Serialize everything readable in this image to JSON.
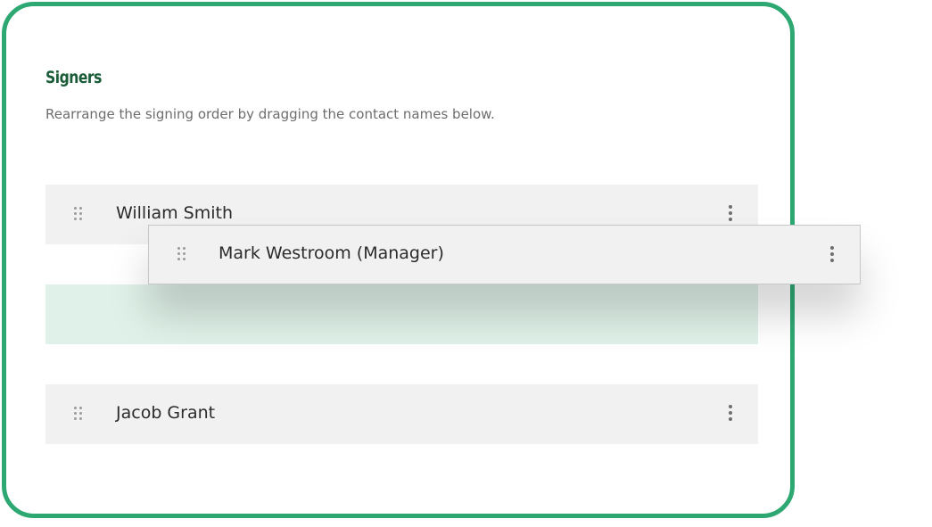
{
  "section": {
    "title": "Signers",
    "description": "Rearrange the signing order by dragging the contact names below."
  },
  "signers": [
    {
      "name": "William Smith"
    },
    {
      "name": "Mark Westroom (Manager)"
    },
    {
      "name": "Jacob Grant"
    }
  ],
  "icons": {
    "handle": "drag-handle-icon",
    "menu": "more-vertical-icon"
  },
  "colors": {
    "accent": "#2ea873",
    "title": "#1a5c38",
    "drop_slot": "#dff1e8",
    "row_background": "#f1f1f1"
  }
}
